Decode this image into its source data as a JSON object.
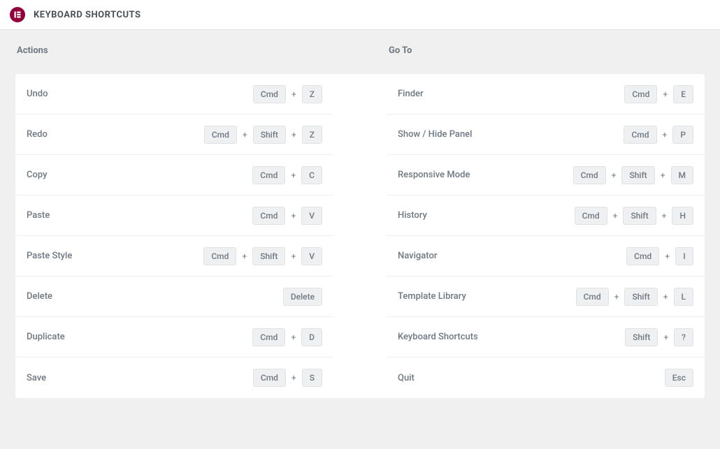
{
  "header": {
    "title": "KEYBOARD SHORTCUTS"
  },
  "sections": {
    "actions": {
      "title": "Actions",
      "rows": [
        {
          "label": "Undo",
          "keys": [
            "Cmd",
            "Z"
          ]
        },
        {
          "label": "Redo",
          "keys": [
            "Cmd",
            "Shift",
            "Z"
          ]
        },
        {
          "label": "Copy",
          "keys": [
            "Cmd",
            "C"
          ]
        },
        {
          "label": "Paste",
          "keys": [
            "Cmd",
            "V"
          ]
        },
        {
          "label": "Paste Style",
          "keys": [
            "Cmd",
            "Shift",
            "V"
          ]
        },
        {
          "label": "Delete",
          "keys": [
            "Delete"
          ]
        },
        {
          "label": "Duplicate",
          "keys": [
            "Cmd",
            "D"
          ]
        },
        {
          "label": "Save",
          "keys": [
            "Cmd",
            "S"
          ]
        }
      ]
    },
    "goto": {
      "title": "Go To",
      "rows": [
        {
          "label": "Finder",
          "keys": [
            "Cmd",
            "E"
          ]
        },
        {
          "label": "Show / Hide Panel",
          "keys": [
            "Cmd",
            "P"
          ]
        },
        {
          "label": "Responsive Mode",
          "keys": [
            "Cmd",
            "Shift",
            "M"
          ]
        },
        {
          "label": "History",
          "keys": [
            "Cmd",
            "Shift",
            "H"
          ]
        },
        {
          "label": "Navigator",
          "keys": [
            "Cmd",
            "I"
          ]
        },
        {
          "label": "Template Library",
          "keys": [
            "Cmd",
            "Shift",
            "L"
          ]
        },
        {
          "label": "Keyboard Shortcuts",
          "keys": [
            "Shift",
            "?"
          ]
        },
        {
          "label": "Quit",
          "keys": [
            "Esc"
          ]
        }
      ]
    }
  }
}
